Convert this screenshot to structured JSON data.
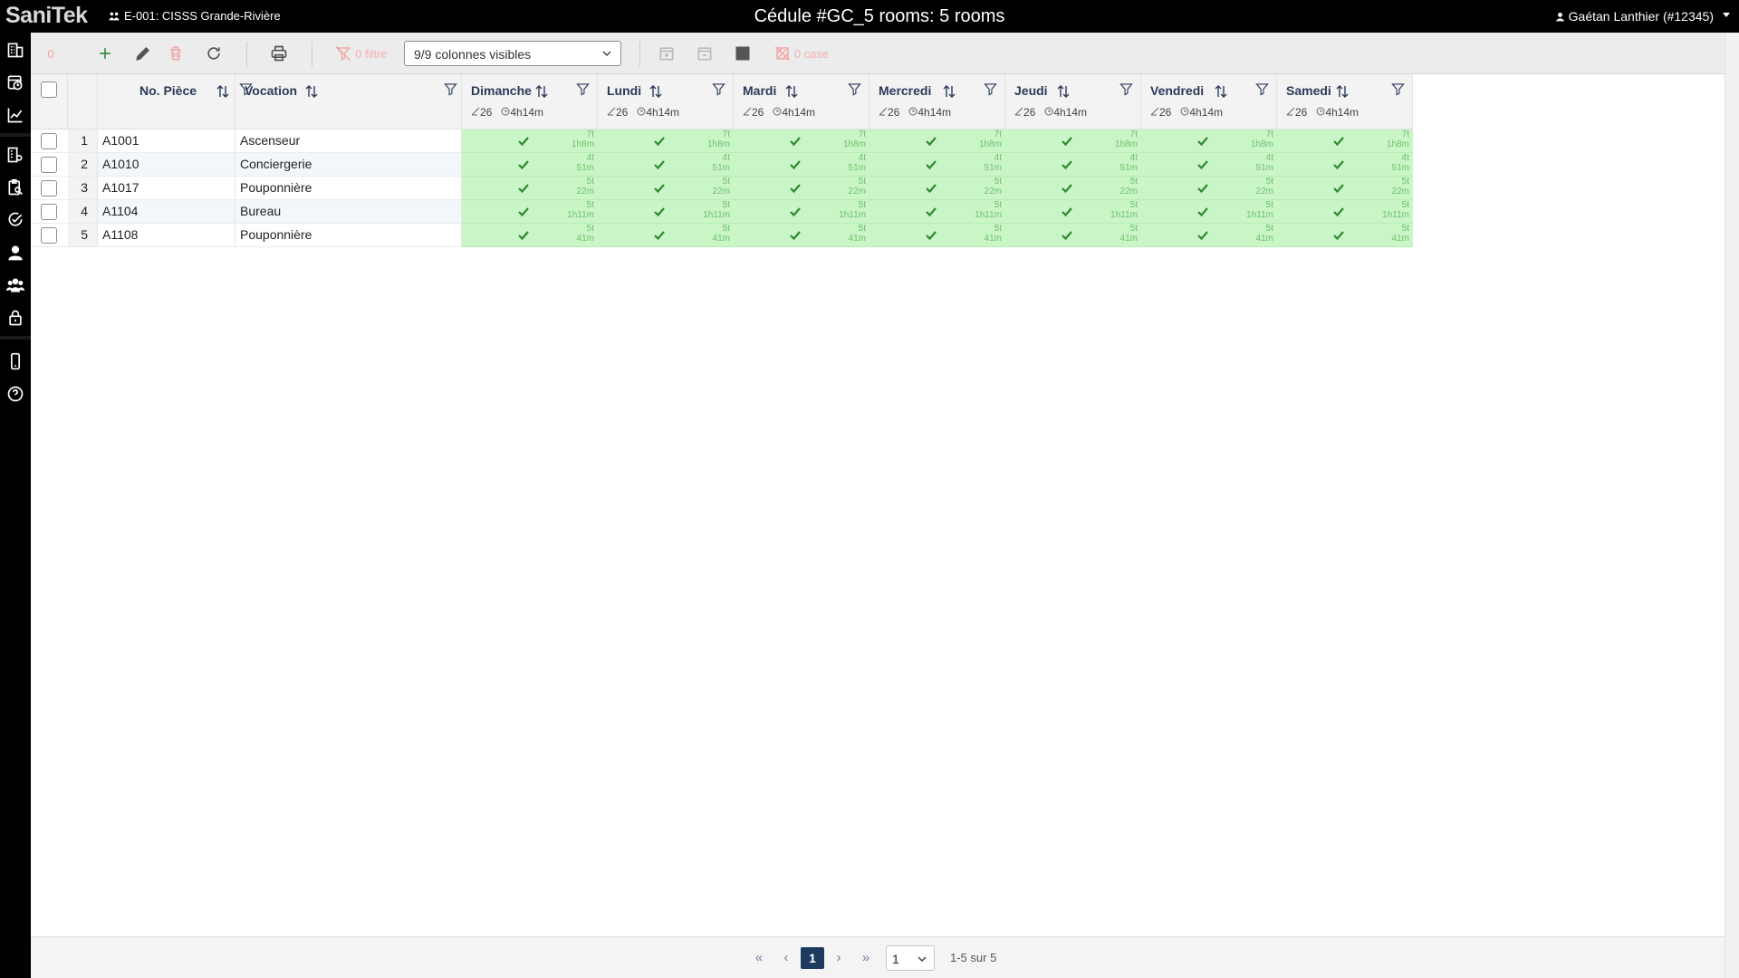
{
  "app": {
    "logo": "SaniTek"
  },
  "header": {
    "site": "E-001: CISSS Grande-Rivière",
    "title": "Cédule #GC_5 rooms: 5 rooms",
    "user": "Gaétan Lanthier (#12345)"
  },
  "toolbar": {
    "selected_count": "0",
    "filter_label": "0 filtre",
    "columns_select": "9/9 colonnes visibles",
    "case_label": "0 case"
  },
  "table": {
    "columns": {
      "room": "No. Pièce",
      "vocation": "Vocation"
    },
    "days": [
      {
        "name": "Dimanche",
        "count": "26",
        "time": "4h14m"
      },
      {
        "name": "Lundi",
        "count": "26",
        "time": "4h14m"
      },
      {
        "name": "Mardi",
        "count": "26",
        "time": "4h14m"
      },
      {
        "name": "Mercredi",
        "count": "26",
        "time": "4h14m"
      },
      {
        "name": "Jeudi",
        "count": "26",
        "time": "4h14m"
      },
      {
        "name": "Vendredi",
        "count": "26",
        "time": "4h14m"
      },
      {
        "name": "Samedi",
        "count": "26",
        "time": "4h14m"
      }
    ],
    "rows": [
      {
        "index": "1",
        "room": "A1001",
        "vocation": "Ascenseur",
        "tasks": "7t",
        "duration": "1h8m"
      },
      {
        "index": "2",
        "room": "A1010",
        "vocation": "Conciergerie",
        "tasks": "4t",
        "duration": "51m"
      },
      {
        "index": "3",
        "room": "A1017",
        "vocation": "Pouponnière",
        "tasks": "5t",
        "duration": "22m"
      },
      {
        "index": "4",
        "room": "A1104",
        "vocation": "Bureau",
        "tasks": "5t",
        "duration": "1h11m"
      },
      {
        "index": "5",
        "room": "A1108",
        "vocation": "Pouponnière",
        "tasks": "5t",
        "duration": "41m"
      }
    ]
  },
  "pagination": {
    "current_page": "1",
    "page_select": "1",
    "info": "1-5 sur 5"
  },
  "colors": {
    "scheduled_cell": "#c9f5c7",
    "accent": "#1d3b5f",
    "header_text": "#2b3a5a"
  }
}
